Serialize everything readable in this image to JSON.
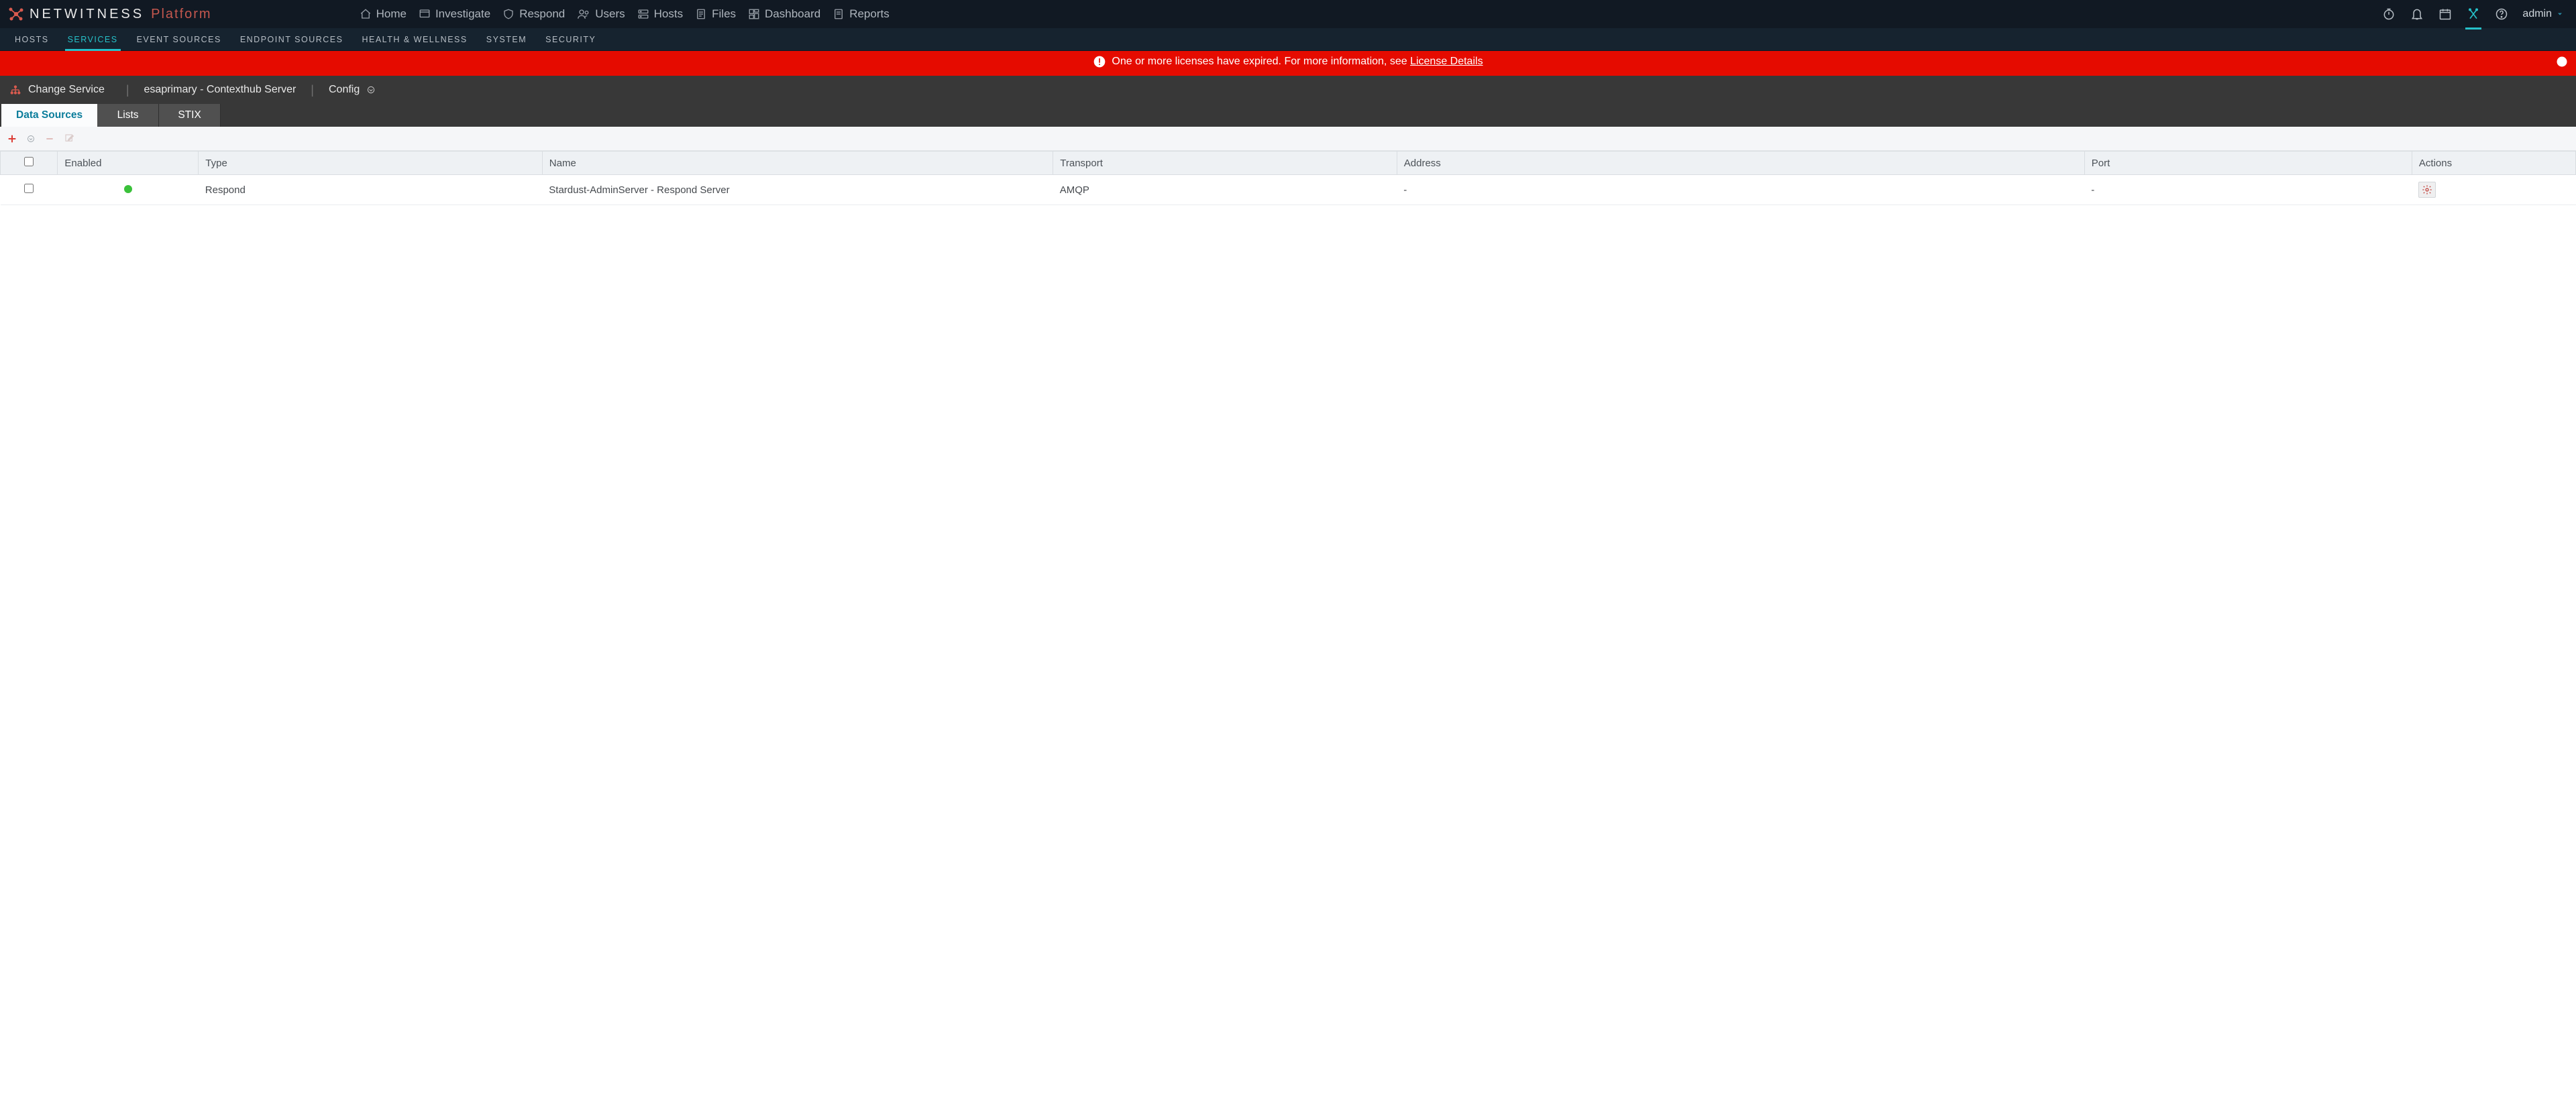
{
  "brand": {
    "name": "NETWITNESS",
    "suffix": "Platform"
  },
  "topnav": {
    "home": "Home",
    "investigate": "Investigate",
    "respond": "Respond",
    "users": "Users",
    "hosts": "Hosts",
    "files": "Files",
    "dashboard": "Dashboard",
    "reports": "Reports"
  },
  "user": {
    "name": "admin"
  },
  "subnav": {
    "hosts": "HOSTS",
    "services": "SERVICES",
    "event_sources": "EVENT SOURCES",
    "endpoint_sources": "ENDPOINT SOURCES",
    "health": "HEALTH & WELLNESS",
    "system": "SYSTEM",
    "security": "SECURITY"
  },
  "alert": {
    "text": "One or more licenses have expired. For more information, see ",
    "link": "License Details"
  },
  "context": {
    "change_service": "Change Service",
    "service_name": "esaprimary - Contexthub Server",
    "page": "Config"
  },
  "tabs": {
    "data_sources": "Data Sources",
    "lists": "Lists",
    "stix": "STIX"
  },
  "columns": {
    "enabled": "Enabled",
    "type": "Type",
    "name": "Name",
    "transport": "Transport",
    "address": "Address",
    "port": "Port",
    "actions": "Actions"
  },
  "rows": [
    {
      "enabled": true,
      "type": "Respond",
      "name": "Stardust-AdminServer - Respond Server",
      "transport": "AMQP",
      "address": "-",
      "port": "-"
    }
  ]
}
